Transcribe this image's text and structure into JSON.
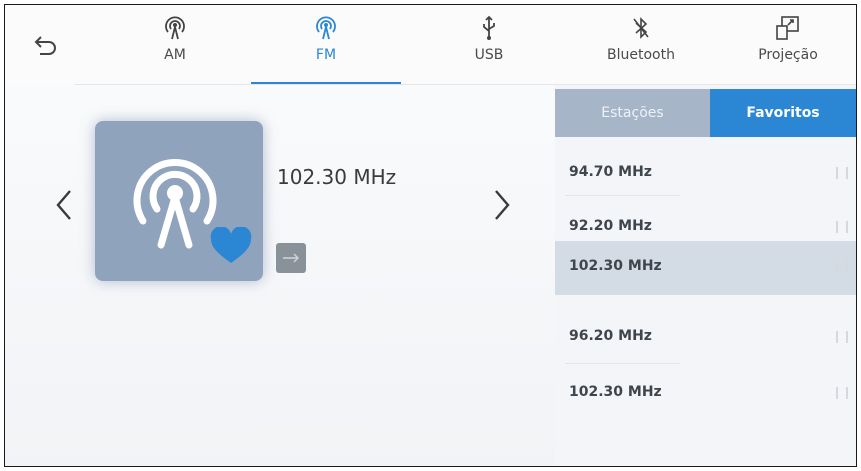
{
  "nav": {
    "back_icon": "back-arrow-icon",
    "tabs": [
      {
        "label": "AM",
        "icon": "radio-antenna-icon",
        "active": false
      },
      {
        "label": "FM",
        "icon": "radio-antenna-icon",
        "active": true
      },
      {
        "label": "USB",
        "icon": "usb-icon",
        "active": false
      },
      {
        "label": "Bluetooth",
        "icon": "bluetooth-off-icon",
        "active": false
      },
      {
        "label": "Projeção",
        "icon": "projection-icon",
        "active": false
      }
    ]
  },
  "player": {
    "frequency": "102.30 MHz",
    "artwork_icon": "radio-antenna-icon",
    "favorite_icon": "heart-icon",
    "action_icon": "arrow-right-icon"
  },
  "list_tabs": {
    "stations": "Estações",
    "favorites": "Favoritos",
    "active": "favorites"
  },
  "favorites": [
    {
      "frequency": "94.70 MHz",
      "selected": false
    },
    {
      "frequency": "92.20 MHz",
      "selected": false
    },
    {
      "frequency": "102.30 MHz",
      "selected": true
    },
    {
      "frequency": "96.20 MHz",
      "selected": false
    },
    {
      "frequency": "102.30 MHz",
      "selected": false
    }
  ],
  "colors": {
    "accent": "#2b86d3",
    "artwork": "#8fa3bd",
    "selected_row": "#d3dbe5"
  }
}
